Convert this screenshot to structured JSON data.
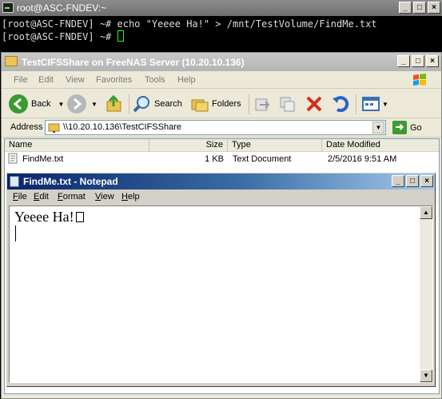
{
  "terminal": {
    "title": "root@ASC-FNDEV:~",
    "lines": [
      "[root@ASC-FNDEV] ~# echo \"Yeeee Ha!\" > /mnt/TestVolume/FindMe.txt",
      "[root@ASC-FNDEV] ~# "
    ]
  },
  "explorer": {
    "title": "TestCIFSShare on FreeNAS Server (10.20.10.136)",
    "menu": [
      "File",
      "Edit",
      "View",
      "Favorites",
      "Tools",
      "Help"
    ],
    "toolbar": {
      "back_label": "Back",
      "search_label": "Search",
      "folders_label": "Folders"
    },
    "address": {
      "label": "Address",
      "value": "\\\\10.20.10.136\\TestCIFSShare",
      "go_label": "Go"
    },
    "columns": [
      "Name",
      "Size",
      "Type",
      "Date Modified"
    ],
    "files": [
      {
        "name": "FindMe.txt",
        "size": "1 KB",
        "type": "Text Document",
        "modified": "2/5/2016 9:51 AM"
      }
    ]
  },
  "notepad": {
    "title": "FindMe.txt - Notepad",
    "menu": [
      "File",
      "Edit",
      "Format",
      "View",
      "Help"
    ],
    "content": "Yeeee Ha!"
  },
  "colors": {
    "terminal_bg": "#000000",
    "notepad_title": "#0a246a",
    "cursor": "#22ff22"
  }
}
